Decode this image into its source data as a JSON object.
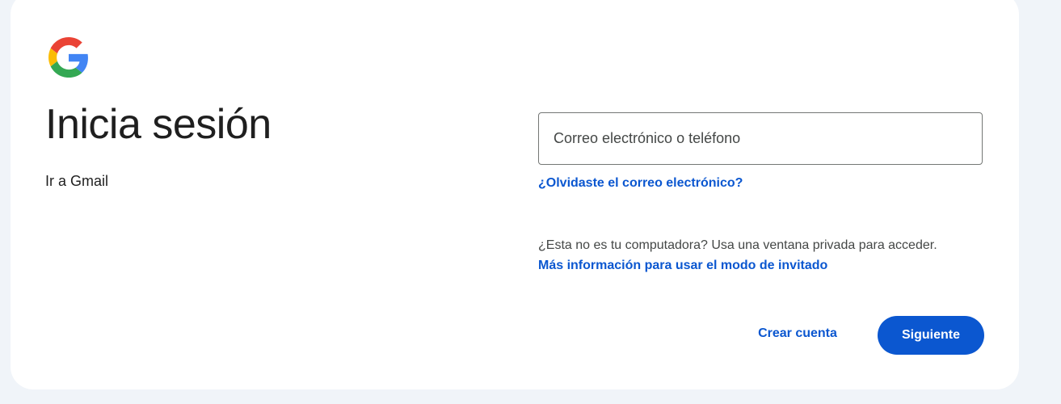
{
  "brand": {
    "logo_icon": "google-g-logo-icon"
  },
  "header": {
    "title": "Inicia sesión",
    "subtitle": "Ir a Gmail"
  },
  "form": {
    "email_placeholder": "Correo electrónico o teléfono",
    "email_value": "",
    "forgot_email_link": "¿Olvidaste el correo electrónico?",
    "private_notice": "¿Esta no es tu computadora? Usa una ventana privada para acceder.",
    "guest_mode_link": "Más información para usar el modo de invitado"
  },
  "actions": {
    "create_account_label": "Crear cuenta",
    "next_label": "Siguiente"
  },
  "colors": {
    "accent": "#0b57d0",
    "background": "#f0f4f9",
    "card": "#ffffff",
    "text": "#1f1f1f"
  }
}
